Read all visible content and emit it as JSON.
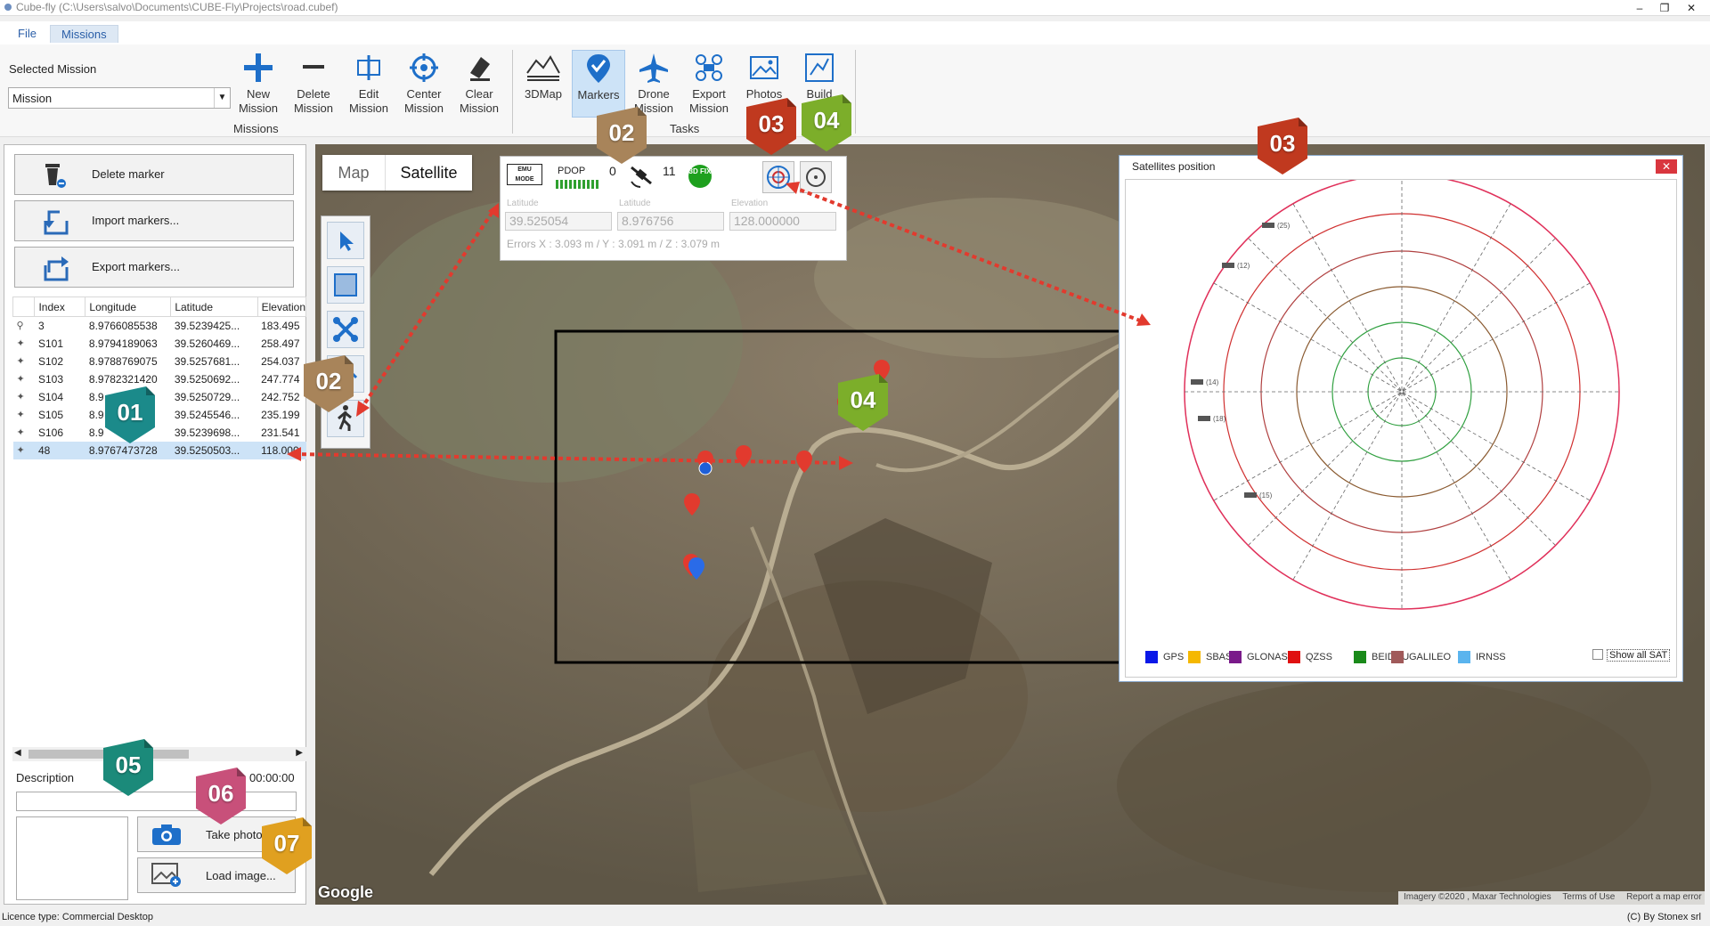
{
  "window": {
    "title": "Cube-fly (C:\\Users\\salvo\\Documents\\CUBE-Fly\\Projects\\road.cubef)"
  },
  "menu": {
    "tabs": [
      {
        "label": "File"
      },
      {
        "label": "Missions"
      }
    ]
  },
  "ribbon": {
    "selected_mission_label": "Selected Mission",
    "mission_select": "Mission",
    "missions_group": "Missions",
    "tasks_group": "Tasks",
    "buttons": [
      {
        "label": "New\nMission",
        "icon": "plus-icon"
      },
      {
        "label": "Delete\nMission",
        "icon": "minus-icon"
      },
      {
        "label": "Edit\nMission",
        "icon": "edit-icon"
      },
      {
        "label": "Center\nMission",
        "icon": "crosshair-icon"
      },
      {
        "label": "Clear\nMission",
        "icon": "eraser-icon"
      },
      {
        "label": "3DMap",
        "icon": "mountain-icon"
      },
      {
        "label": "Markers",
        "icon": "marker-icon"
      },
      {
        "label": "Drone\nMission",
        "icon": "plane-icon"
      },
      {
        "label": "Export\nMission",
        "icon": "export-icon"
      },
      {
        "label": "Photos",
        "icon": "photo-icon"
      },
      {
        "label": "Build",
        "icon": "build-icon"
      }
    ]
  },
  "left": {
    "delete_marker": "Delete marker",
    "import_markers": "Import markers...",
    "export_markers": "Export markers...",
    "columns": [
      "Index",
      "Longitude",
      "Latitude",
      "Elevation"
    ],
    "rows": [
      {
        "index": "3",
        "lon": "8.9766085538",
        "lat": "39.5239425...",
        "elev": "183.495"
      },
      {
        "index": "S101",
        "lon": "8.9794189063",
        "lat": "39.5260469...",
        "elev": "258.497"
      },
      {
        "index": "S102",
        "lon": "8.9788769075",
        "lat": "39.5257681...",
        "elev": "254.037"
      },
      {
        "index": "S103",
        "lon": "8.9782321420",
        "lat": "39.5250692...",
        "elev": "247.774"
      },
      {
        "index": "S104",
        "lon": "8.9",
        "lat": "39.5250729...",
        "elev": "242.752"
      },
      {
        "index": "S105",
        "lon": "8.9",
        "lat": "39.5245546...",
        "elev": "235.199"
      },
      {
        "index": "S106",
        "lon": "8.9",
        "lat": "39.5239698...",
        "elev": "231.541"
      },
      {
        "index": "48",
        "lon": "8.9767473728",
        "lat": "39.5250503...",
        "elev": "118.000"
      }
    ],
    "description_label": "Description",
    "time": "00:00:00",
    "take_photo": "Take photo...",
    "load_image": "Load image..."
  },
  "map": {
    "tab_map": "Map",
    "tab_satellite": "Satellite",
    "google": "Google",
    "attribution": "Imagery ©2020 , Maxar Technologies",
    "terms": "Terms of Use",
    "report": "Report a map error"
  },
  "gps": {
    "mode": "EMU MODE",
    "pdop_label": "PDOP",
    "pdop_value": "0",
    "sat_count": "11",
    "fix": "3D FIX",
    "latitude_label1": "Latitude",
    "latitude_value1": "39.525054",
    "latitude_label2": "Latitude",
    "latitude_value2": "8.976756",
    "elevation_label": "Elevation",
    "elevation_value": "128.000000",
    "errors": "Errors  X : 3.093 m /  Y : 3.091 m / Z : 3.079 m"
  },
  "satwin": {
    "title": "Satellites position",
    "sats": [
      "(25)",
      "(12)",
      "(14)",
      "(18)",
      "(15)"
    ],
    "legend": [
      {
        "name": "GPS",
        "color": "#0a18e8"
      },
      {
        "name": "SBAS",
        "color": "#f5b800"
      },
      {
        "name": "GLONASS",
        "color": "#7a1a8a"
      },
      {
        "name": "QZSS",
        "color": "#e01010"
      },
      {
        "name": "BEIDOU",
        "color": "#1a8a1a"
      },
      {
        "name": "GALILEO",
        "color": "#a05a5a"
      },
      {
        "name": "IRNSS",
        "color": "#5ab4ee"
      }
    ],
    "show_all": "Show all SAT"
  },
  "badges": [
    {
      "label": "01",
      "color": "#1b8a8a"
    },
    {
      "label": "02",
      "color": "#a8845a"
    },
    {
      "label": "02",
      "color": "#a8845a"
    },
    {
      "label": "03",
      "color": "#c0391f"
    },
    {
      "label": "03",
      "color": "#c0391f"
    },
    {
      "label": "04",
      "color": "#7cae2a"
    },
    {
      "label": "04",
      "color": "#7cae2a"
    },
    {
      "label": "05",
      "color": "#1b8a7a"
    },
    {
      "label": "06",
      "color": "#c8507a"
    },
    {
      "label": "07",
      "color": "#e0a020"
    }
  ],
  "status": {
    "licence": "Licence type: Commercial Desktop",
    "copyright": "(C) By Stonex srl"
  }
}
